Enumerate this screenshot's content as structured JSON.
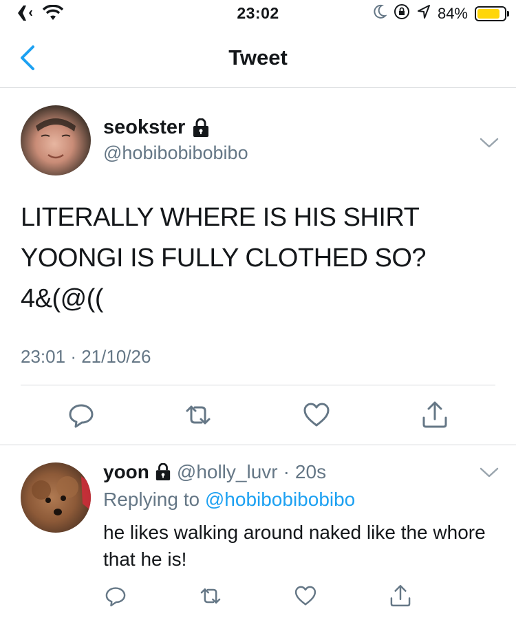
{
  "status_bar": {
    "time": "23:02",
    "battery_percent": "84%",
    "battery_level": 0.84,
    "icons": [
      "airplane-icon",
      "wifi-icon",
      "moon-icon",
      "orientation-lock-icon",
      "location-icon",
      "battery-icon"
    ]
  },
  "nav": {
    "title": "Tweet",
    "back_icon": "chevron-left-icon"
  },
  "tweet": {
    "author_name": "seokster",
    "author_handle": "@hobibobibobibo",
    "protected": true,
    "text_lines": [
      "LITERALLY WHERE IS HIS SHIRT",
      "YOONGI IS FULLY CLOTHED SO?",
      "4&(@(("
    ],
    "time": "23:01",
    "date": "21/10/26",
    "meta_separator": "·",
    "actions": [
      "reply-icon",
      "retweet-icon",
      "like-icon",
      "share-icon"
    ]
  },
  "reply": {
    "author_name": "yoon",
    "author_handle": "@holly_luvr",
    "separator": "·",
    "age": "20s",
    "protected": true,
    "replying_prefix": "Replying to ",
    "replying_to": "@hobibobibobibo",
    "text": "he likes walking around naked like the whore that he is!",
    "actions": [
      "reply-icon",
      "retweet-icon",
      "like-icon",
      "share-icon"
    ]
  },
  "colors": {
    "accent": "#1da1f2",
    "secondary_text": "#657786",
    "primary_text": "#14171a",
    "divider": "#d6d9db",
    "battery": "#ffd60a"
  }
}
